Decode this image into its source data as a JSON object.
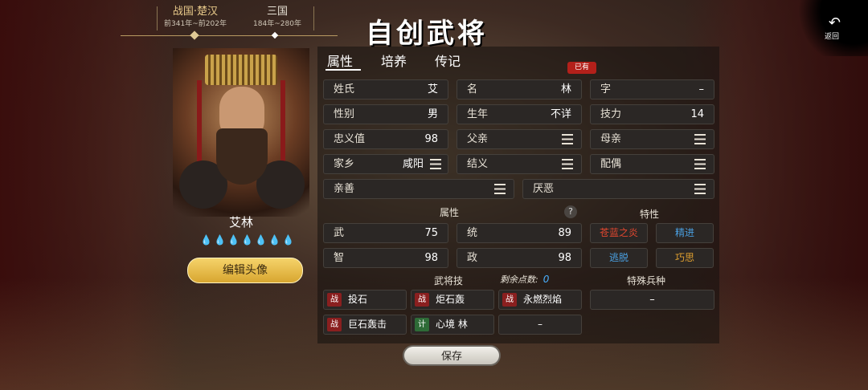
{
  "era": {
    "left": {
      "name": "战国·楚汉",
      "years": "前341年~前202年"
    },
    "right": {
      "name": "三国",
      "years": "184年~280年"
    }
  },
  "title": "自创武将",
  "return_label": "返回",
  "character": {
    "name": "艾林",
    "drop_count": 7,
    "edit_avatar": "编辑头像"
  },
  "tabs": [
    "属性",
    "培养",
    "传记"
  ],
  "owned_badge": "已有",
  "profile": {
    "surname": {
      "label": "姓氏",
      "value": "艾"
    },
    "given": {
      "label": "名",
      "value": "林"
    },
    "courtesy": {
      "label": "字",
      "value": "–"
    },
    "gender": {
      "label": "性别",
      "value": "男"
    },
    "birth": {
      "label": "生年",
      "value": "不详"
    },
    "skill_power": {
      "label": "技力",
      "value": "14"
    },
    "loyalty": {
      "label": "忠义值",
      "value": "98"
    },
    "father": {
      "label": "父亲"
    },
    "mother": {
      "label": "母亲"
    },
    "hometown": {
      "label": "家乡",
      "value": "咸阳"
    },
    "sworn": {
      "label": "结义"
    },
    "spouse": {
      "label": "配偶"
    },
    "likes": {
      "label": "亲善"
    },
    "dislikes": {
      "label": "厌恶"
    }
  },
  "attributes": {
    "title": "属性",
    "help": "?",
    "war": {
      "label": "武",
      "value": "75"
    },
    "lead": {
      "label": "统",
      "value": "89"
    },
    "intel": {
      "label": "智",
      "value": "98"
    },
    "politics": {
      "label": "政",
      "value": "98"
    }
  },
  "traits": {
    "title": "特性",
    "items": [
      {
        "label": "苍蓝之炎",
        "color": "#e0472f"
      },
      {
        "label": "精进",
        "color": "#4a9fe0"
      },
      {
        "label": "逃脱",
        "color": "#4a9fe0"
      },
      {
        "label": "巧思",
        "color": "#e0a030"
      }
    ]
  },
  "skills": {
    "title": "武将技",
    "remain_label": "剩余点数:",
    "remain_value": "0",
    "items": [
      {
        "tag": "战",
        "name": "投石"
      },
      {
        "tag": "战",
        "name": "炬石轰"
      },
      {
        "tag": "战",
        "name": "永燃烈焰"
      },
      {
        "tag": "战",
        "name": "巨石轰击"
      },
      {
        "tag": "计",
        "name": "心境 林"
      },
      {
        "empty": "–"
      }
    ]
  },
  "special_troop": {
    "title": "特殊兵种",
    "value": "–"
  },
  "save_label": "保存"
}
